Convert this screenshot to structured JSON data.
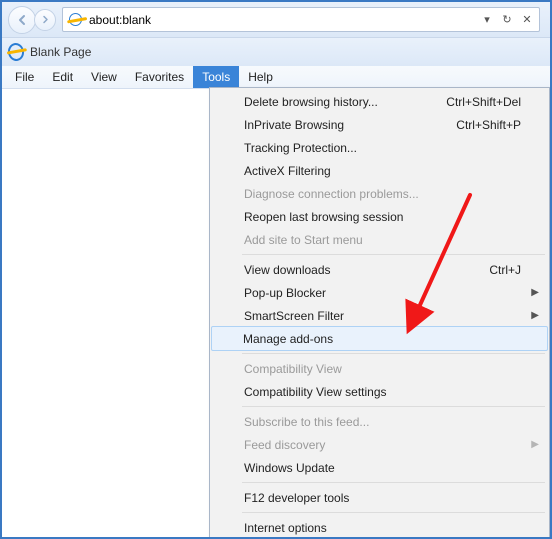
{
  "address": {
    "value": "about:blank"
  },
  "tab": {
    "title": "Blank Page"
  },
  "menubar": [
    "File",
    "Edit",
    "View",
    "Favorites",
    "Tools",
    "Help"
  ],
  "active_menu_index": 4,
  "tools_menu": [
    {
      "type": "item",
      "label": "Delete browsing history...",
      "shortcut": "Ctrl+Shift+Del"
    },
    {
      "type": "item",
      "label": "InPrivate Browsing",
      "shortcut": "Ctrl+Shift+P"
    },
    {
      "type": "item",
      "label": "Tracking Protection..."
    },
    {
      "type": "item",
      "label": "ActiveX Filtering"
    },
    {
      "type": "item",
      "label": "Diagnose connection problems...",
      "disabled": true
    },
    {
      "type": "item",
      "label": "Reopen last browsing session"
    },
    {
      "type": "item",
      "label": "Add site to Start menu",
      "disabled": true
    },
    {
      "type": "sep"
    },
    {
      "type": "item",
      "label": "View downloads",
      "shortcut": "Ctrl+J"
    },
    {
      "type": "item",
      "label": "Pop-up Blocker",
      "submenu": true
    },
    {
      "type": "item",
      "label": "SmartScreen Filter",
      "submenu": true
    },
    {
      "type": "item",
      "label": "Manage add-ons",
      "highlight": true
    },
    {
      "type": "sep"
    },
    {
      "type": "item",
      "label": "Compatibility View",
      "disabled": true
    },
    {
      "type": "item",
      "label": "Compatibility View settings"
    },
    {
      "type": "sep"
    },
    {
      "type": "item",
      "label": "Subscribe to this feed...",
      "disabled": true
    },
    {
      "type": "item",
      "label": "Feed discovery",
      "disabled": true,
      "submenu": true
    },
    {
      "type": "item",
      "label": "Windows Update"
    },
    {
      "type": "sep"
    },
    {
      "type": "item",
      "label": "F12 developer tools"
    },
    {
      "type": "sep"
    },
    {
      "type": "item",
      "label": "Internet options"
    }
  ]
}
